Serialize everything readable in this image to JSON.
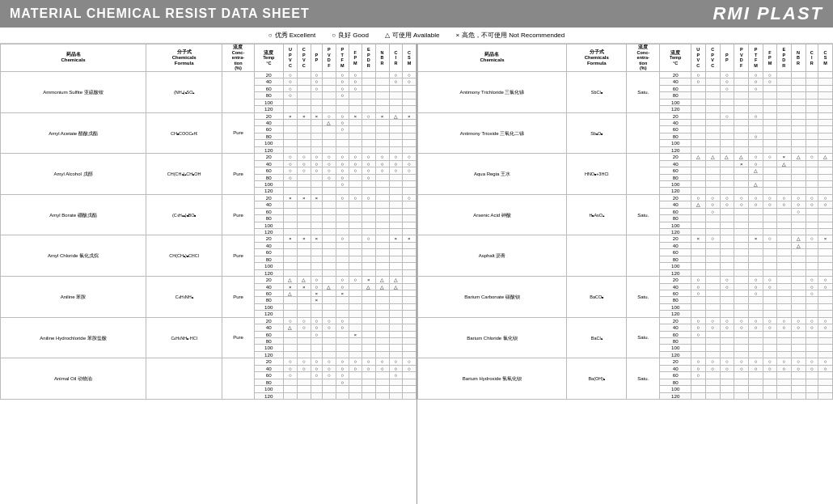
{
  "header": {
    "title": "MATERIAL CHEMICAL RESIST DATA SHEET",
    "brand": "RMI PLAST"
  },
  "legend": {
    "excellent": "优秀 Excellent",
    "good": "良好 Good",
    "available": "可使用 Available",
    "not_recommended": "高危，不可使用 Not Recommended"
  },
  "columns": [
    "药品名 Chemicals",
    "分子式 Chemicals Formula",
    "流度 Conc-entra-tion (%)",
    "流度 Temp °C",
    "U P V C",
    "C P V C",
    "P P",
    "P V D F",
    "P T F M",
    "F P M",
    "E P D R",
    "N B R",
    "C I R",
    "C S M"
  ],
  "col_abbr": [
    "U P V C",
    "C P V C",
    "P P",
    "P V D F",
    "P T F M",
    "F P M",
    "E P D R",
    "N B R",
    "C I R",
    "C S M"
  ],
  "left_chemicals": [
    {
      "name": "Ammonium Sulfite 亚硫酸铵",
      "formula": "(NH₄)₂SO₄",
      "conc": "",
      "temps": [
        20,
        40,
        60,
        80,
        100,
        120
      ]
    },
    {
      "name": "Amyl Acetate 醋酸戊酯",
      "formula": "CH₃COOCₙHᵢ",
      "conc": "Pure",
      "temps": [
        20,
        40,
        60,
        80,
        100,
        120
      ]
    },
    {
      "name": "Amyl Alcohol 戊醇",
      "formula": "CH(CH₂)₄CH₂OH",
      "conc": "Pure",
      "temps": [
        20,
        40,
        60,
        80,
        100,
        120
      ]
    },
    {
      "name": "Amyl Borate 硼酸戊酯",
      "formula": "(C₅H₁₁)₃BO₃",
      "conc": "Pure",
      "temps": [
        20,
        40,
        60,
        80,
        100,
        120
      ]
    },
    {
      "name": "Amyl Chloride 氯化戊烷",
      "formula": "CH(CH₂)₃CHCl",
      "conc": "Pure",
      "temps": [
        20,
        40,
        60,
        80,
        100,
        120
      ]
    },
    {
      "name": "Aniline 苯胺",
      "formula": "C₆H₅NH₂",
      "conc": "Pure",
      "temps": [
        20,
        40,
        60,
        80,
        100,
        120
      ]
    },
    {
      "name": "Aniline Hydrochloride 苯胺盐酸",
      "formula": "C₆H₅NH₂·HCl",
      "conc": "Pure",
      "temps": [
        20,
        40,
        60,
        80,
        100,
        120
      ]
    },
    {
      "name": "Animal Oil 动物油",
      "formula": "",
      "conc": "",
      "temps": [
        20,
        40,
        60,
        80,
        100,
        120
      ]
    }
  ],
  "right_chemicals": [
    {
      "name": "Antimony Trichloride 三氯化锑",
      "formula": "SbCl₃",
      "conc": "Satu.",
      "temps": [
        20,
        40,
        60,
        80,
        100,
        120
      ]
    },
    {
      "name": "Antimony Trioxide 三氧化二锑",
      "formula": "Sb₂O₃",
      "conc": "",
      "temps": [
        20,
        40,
        60,
        80,
        100,
        120
      ]
    },
    {
      "name": "Aqua Regia 王水",
      "formula": "HNO₃+3HCl",
      "conc": "",
      "temps": [
        20,
        40,
        60,
        80,
        100,
        120
      ]
    },
    {
      "name": "Arsenic Acid 砷酸",
      "formula": "H₃AsO₄",
      "conc": "Satu.",
      "temps": [
        20,
        40,
        60,
        80,
        100,
        120
      ]
    },
    {
      "name": "Asphalt 沥青",
      "formula": "",
      "conc": "",
      "temps": [
        20,
        40,
        60,
        80,
        100,
        120
      ]
    },
    {
      "name": "Barium Carbonate 碳酸钡",
      "formula": "BaCO₃",
      "conc": "Satu.",
      "temps": [
        20,
        40,
        60,
        80,
        100,
        120
      ]
    },
    {
      "name": "Barium Chloride 氯化钡",
      "formula": "BaCl₂",
      "conc": "Satu.",
      "temps": [
        20,
        40,
        60,
        80,
        100,
        120
      ]
    },
    {
      "name": "Barium Hydroxide 氢氧化钡",
      "formula": "Ba(OH)₂",
      "conc": "Satu.",
      "temps": [
        20,
        40,
        60,
        80,
        100,
        120
      ]
    }
  ]
}
